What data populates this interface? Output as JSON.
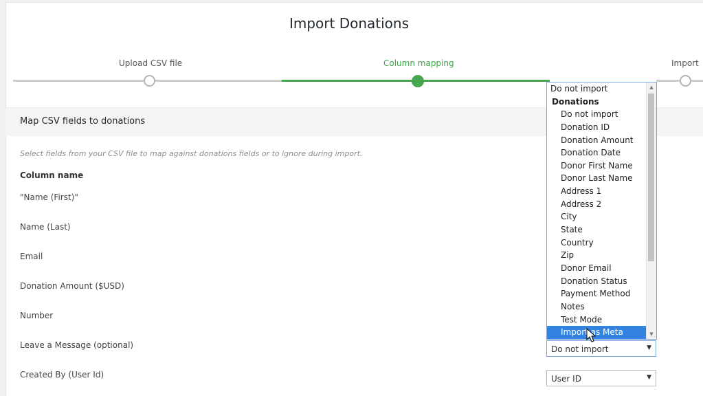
{
  "page_title": "Import Donations",
  "steps": [
    {
      "label": "Upload CSV file",
      "state": "done"
    },
    {
      "label": "Column mapping",
      "state": "active"
    },
    {
      "label": "Import",
      "state": "pending"
    }
  ],
  "colors": {
    "active_step": "#48a64f",
    "selected_option": "#3384e0",
    "focus_border": "#7aa8e0"
  },
  "section": {
    "title": "Map CSV fields to donations",
    "hint": "Select fields from your CSV file to map against donations fields or to ignore during import.",
    "column_header": "Column name"
  },
  "rows": [
    {
      "label": "\"Name (First)\""
    },
    {
      "label": "Name (Last)"
    },
    {
      "label": "Email"
    },
    {
      "label": "Donation Amount ($USD)"
    },
    {
      "label": "Number"
    },
    {
      "label": "Leave a Message (optional)",
      "select_value": "Do not import"
    },
    {
      "label": "Created By (User Id)",
      "select_value": "User ID"
    }
  ],
  "dropdown": {
    "top_option": "Do not import",
    "group_label": "Donations",
    "options": [
      "Do not import",
      "Donation ID",
      "Donation Amount",
      "Donation Date",
      "Donor First Name",
      "Donor Last Name",
      "Address 1",
      "Address 2",
      "City",
      "State",
      "Country",
      "Zip",
      "Donor Email",
      "Donation Status",
      "Payment Method",
      "Notes",
      "Test Mode",
      "Import as Meta"
    ],
    "selected": "Import as Meta"
  },
  "icons": {
    "caret": "caret-down-icon",
    "scroll_up": "scroll-up-arrow-icon",
    "scroll_down": "scroll-down-arrow-icon",
    "cursor": "mouse-pointer-icon"
  }
}
